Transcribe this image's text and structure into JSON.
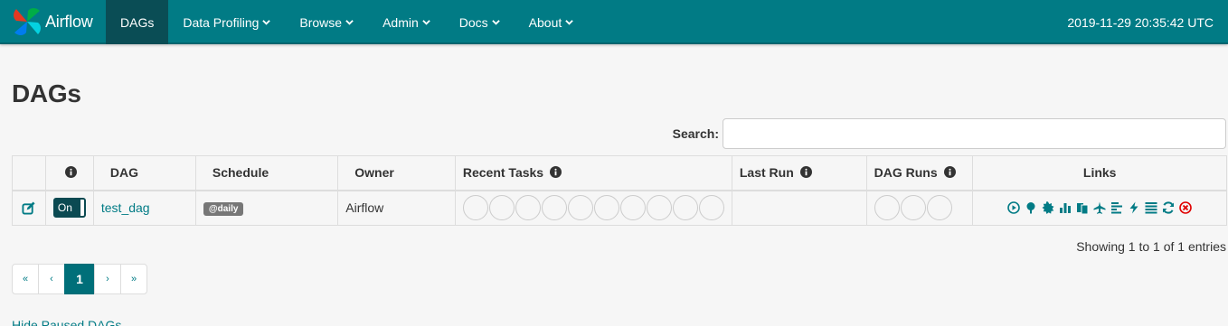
{
  "navbar": {
    "brand": "Airflow",
    "items": [
      {
        "label": "DAGs",
        "dropdown": false,
        "active": true
      },
      {
        "label": "Data Profiling",
        "dropdown": true
      },
      {
        "label": "Browse",
        "dropdown": true
      },
      {
        "label": "Admin",
        "dropdown": true
      },
      {
        "label": "Docs",
        "dropdown": true
      },
      {
        "label": "About",
        "dropdown": true
      }
    ],
    "clock": "2019-11-29 20:35:42 UTC",
    "colors": {
      "bar": "#017b85",
      "active": "#0a4d55"
    }
  },
  "page": {
    "title": "DAGs"
  },
  "search": {
    "label": "Search:",
    "value": ""
  },
  "table": {
    "headers": {
      "dag": "DAG",
      "schedule": "Schedule",
      "owner": "Owner",
      "recent_tasks": "Recent Tasks",
      "last_run": "Last Run",
      "dag_runs": "DAG Runs",
      "links": "Links"
    },
    "rows": [
      {
        "toggle": "On",
        "dag_id": "test_dag",
        "schedule": "@daily",
        "owner": "Airflow",
        "last_run": "",
        "recent_task_circles": 10,
        "dag_run_circles": 3
      }
    ],
    "link_icons": [
      "trigger-dag-icon",
      "tree-view-icon",
      "graph-view-icon",
      "task-duration-icon",
      "task-tries-icon",
      "landing-times-icon",
      "gantt-icon",
      "code-icon",
      "logs-icon",
      "refresh-icon",
      "delete-dag-icon"
    ]
  },
  "footer": {
    "entries": "Showing 1 to 1 of 1 entries",
    "pagination": [
      "«",
      "‹",
      "1",
      "›",
      "»"
    ],
    "current_page": "1",
    "hide_paused": "Hide Paused DAGs"
  }
}
